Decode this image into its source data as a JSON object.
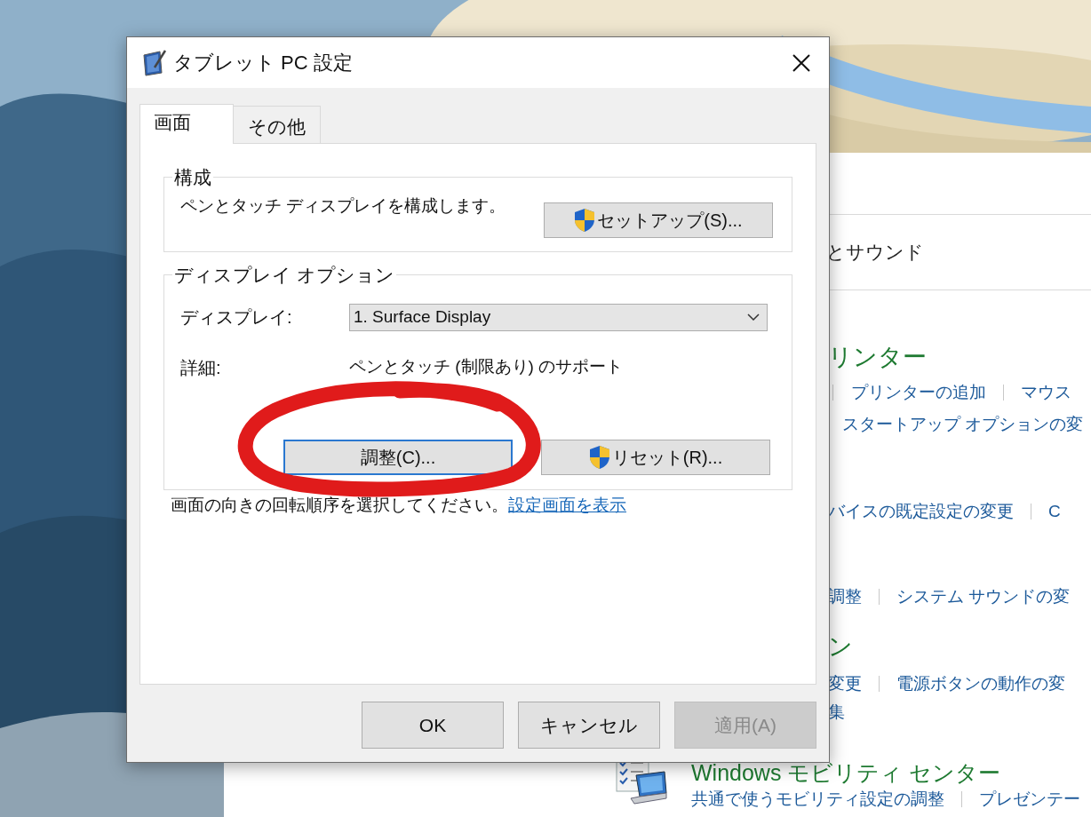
{
  "control_panel": {
    "category": "とサウンド",
    "lines": [
      {
        "kind": "heading",
        "text": "リンター"
      },
      {
        "kind": "links",
        "leading_divider": true,
        "links": [
          "プリンターの追加",
          "マウス"
        ]
      },
      {
        "kind": "links",
        "leading_divider": false,
        "links": [
          "スタートアップ オプションの変"
        ]
      },
      {
        "kind": "links",
        "leading_divider": false,
        "links": [
          "バイスの既定設定の変更",
          "C"
        ]
      },
      {
        "kind": "links",
        "leading_divider": false,
        "links": [
          "調整",
          "システム サウンドの変"
        ]
      },
      {
        "kind": "heading",
        "text": "ン"
      },
      {
        "kind": "links",
        "leading_divider": false,
        "links": [
          "変更",
          "電源ボタンの動作の変"
        ]
      },
      {
        "kind": "links",
        "leading_divider": false,
        "links": [
          "集"
        ]
      }
    ],
    "mobility": {
      "heading": "Windows モビリティ センター",
      "links": [
        "共通で使うモビリティ設定の調整",
        "プレゼンテー"
      ]
    }
  },
  "dialog": {
    "title": "タブレット PC 設定",
    "tabs": [
      {
        "label": "画面",
        "selected": true
      },
      {
        "label": "その他",
        "selected": false
      }
    ],
    "configure_group": {
      "title": "構成",
      "description": "ペンとタッチ ディスプレイを構成します。",
      "button": {
        "label": "セットアップ(S)...",
        "shield": true
      }
    },
    "display_group": {
      "title": "ディスプレイ オプション",
      "display_label": "ディスプレイ:",
      "display_value": "1. Surface Display",
      "details_label": "詳細:",
      "details_value": "ペンとタッチ (制限あり) のサポート",
      "buttons": [
        {
          "label": "調整(C)...",
          "shield": false,
          "focused": true
        },
        {
          "label": "リセット(R)...",
          "shield": true,
          "focused": false
        }
      ]
    },
    "rotation_note": {
      "text": "画面の向きの回転順序を選択してください。",
      "link": "設定画面を表示"
    },
    "footer_buttons": [
      {
        "label": "OK",
        "disabled": false
      },
      {
        "label": "キャンセル",
        "disabled": false
      },
      {
        "label": "適用(A)",
        "disabled": true
      }
    ]
  },
  "annotation": {
    "kind": "circle"
  }
}
